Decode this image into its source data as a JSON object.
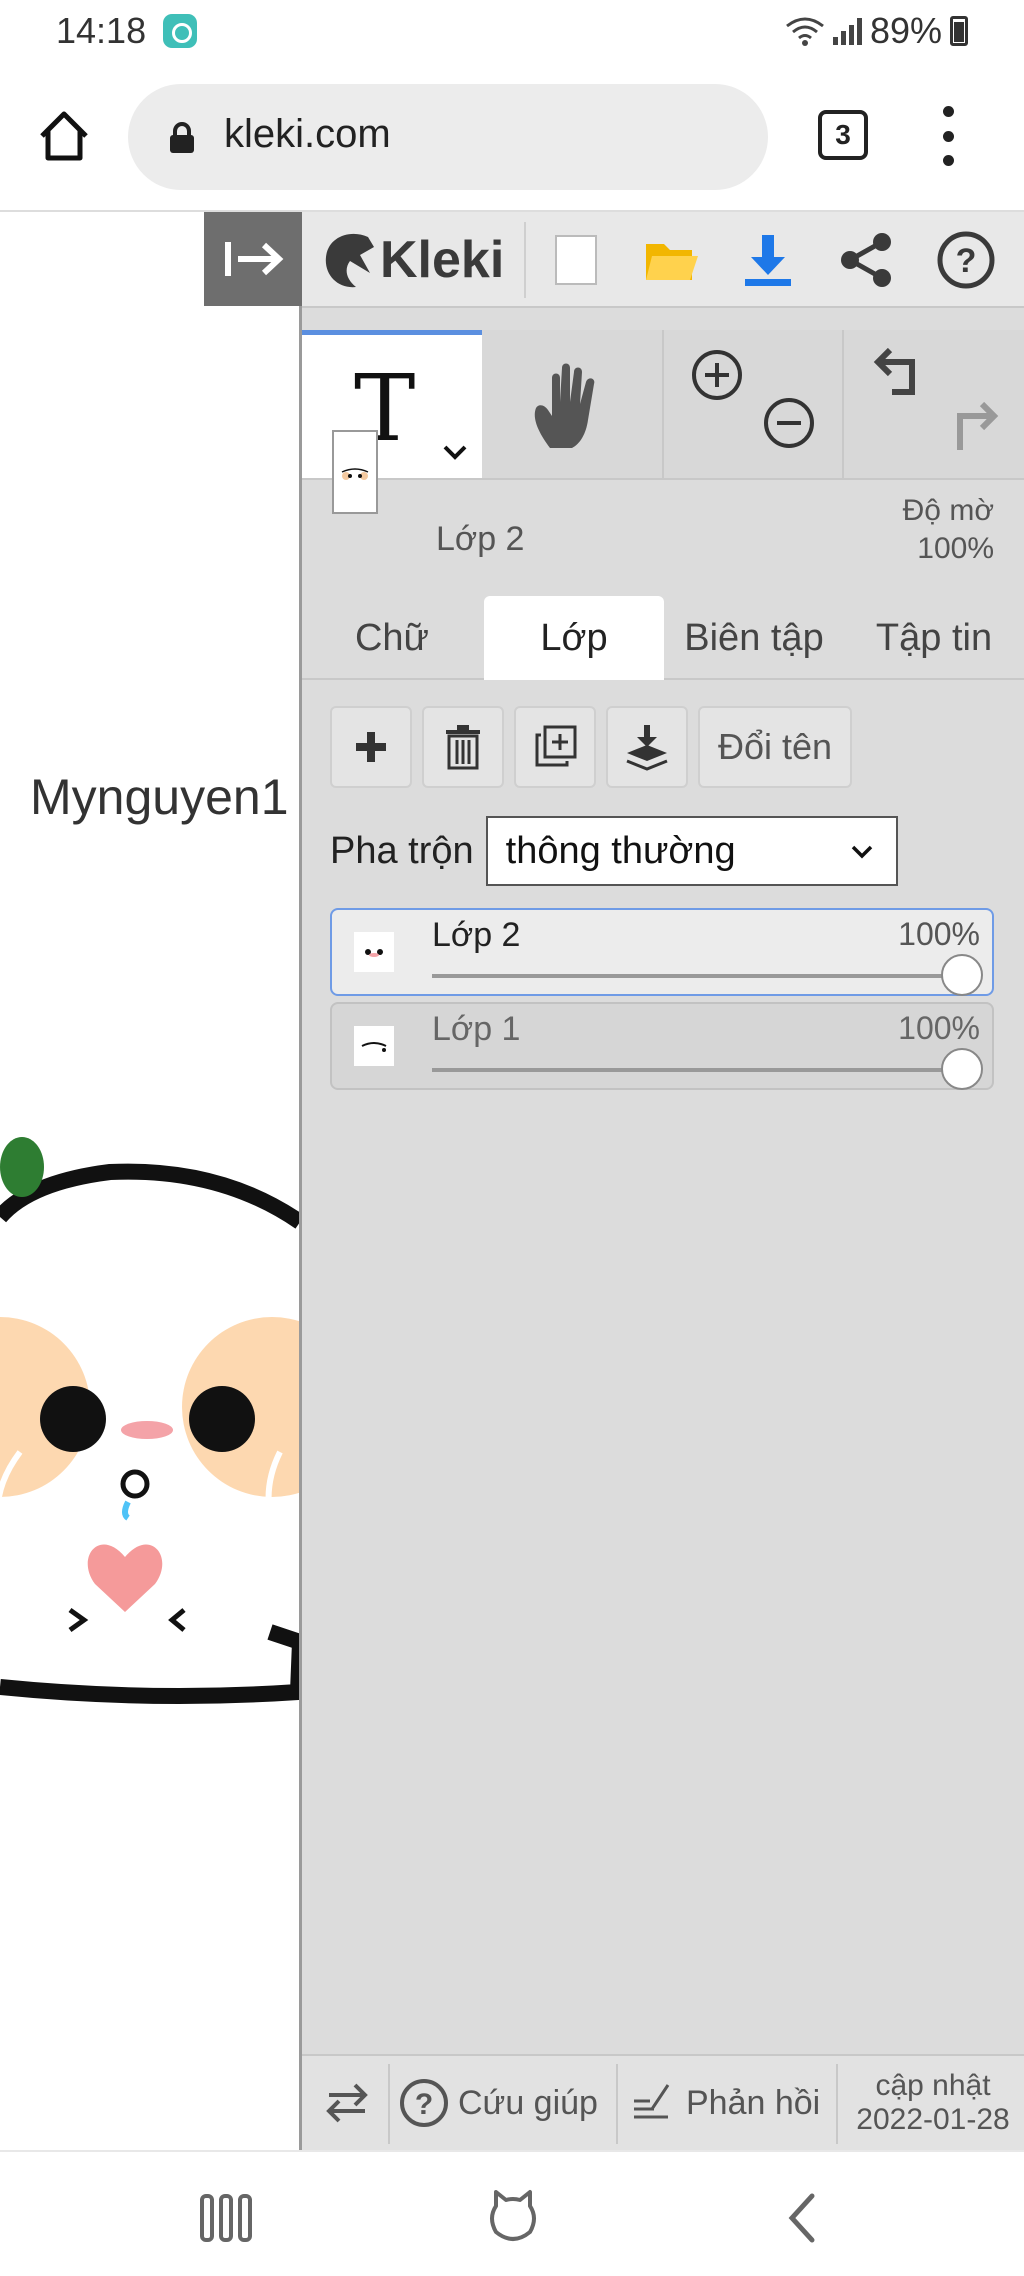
{
  "status_bar": {
    "time": "14:18",
    "battery": "89%"
  },
  "browser": {
    "url": "kleki.com",
    "tab_count": "3"
  },
  "canvas": {
    "text_layer": "Mynguyen1"
  },
  "toolbar": {
    "logo_text": "Kleki",
    "icons": [
      "new-image-icon",
      "open-folder-icon",
      "download-icon",
      "share-icon",
      "help-icon"
    ],
    "accent": "#5b8fe0"
  },
  "tools": {
    "active_tool": "T"
  },
  "current_layer": {
    "name": "Lớp 2",
    "opacity_label": "Độ mờ",
    "opacity_value": "100%"
  },
  "tabs": [
    {
      "label": "Chữ"
    },
    {
      "label": "Lớp"
    },
    {
      "label": "Biên tập"
    },
    {
      "label": "Tập tin"
    }
  ],
  "active_tab": "Lớp",
  "layer_actions": {
    "rename_label": "Đổi tên"
  },
  "blend": {
    "label": "Pha trộn",
    "selected": "thông thường"
  },
  "layers": [
    {
      "name": "Lớp 2",
      "opacity": "100%",
      "opacity_level": 1.0,
      "active": true
    },
    {
      "name": "Lớp 1",
      "opacity": "100%",
      "opacity_level": 1.0,
      "active": false
    }
  ],
  "footer": {
    "help_label": "Cứu giúp",
    "feedback_label": "Phản hồi",
    "update_label": "cập nhật",
    "update_date": "2022-01-28"
  }
}
